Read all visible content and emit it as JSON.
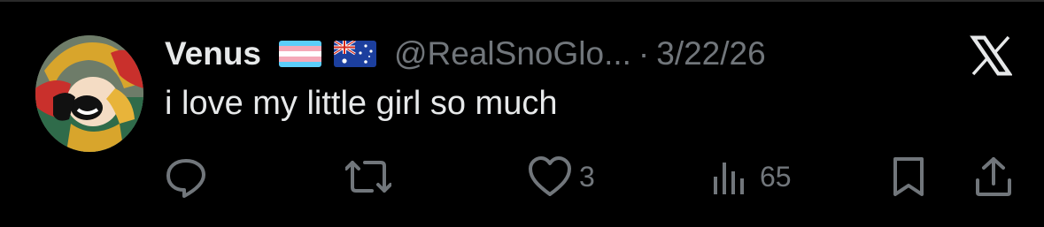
{
  "tweet": {
    "author_name": "Venus",
    "flags": [
      "transgender-flag",
      "australia-flag"
    ],
    "handle": "@RealSnoGlo...",
    "separator": "·",
    "date": "3/22/26",
    "text": "i love my little girl so much"
  },
  "actions": {
    "reply_count": "",
    "retweet_count": "",
    "like_count": "3",
    "views_count": "65"
  },
  "icons": {
    "platform": "x-logo-icon",
    "reply": "reply-icon",
    "retweet": "retweet-icon",
    "like": "heart-icon",
    "views": "views-icon",
    "bookmark": "bookmark-icon",
    "share": "share-icon"
  },
  "colors": {
    "background": "#000000",
    "text": "#e7e9ea",
    "muted": "#71767b"
  }
}
